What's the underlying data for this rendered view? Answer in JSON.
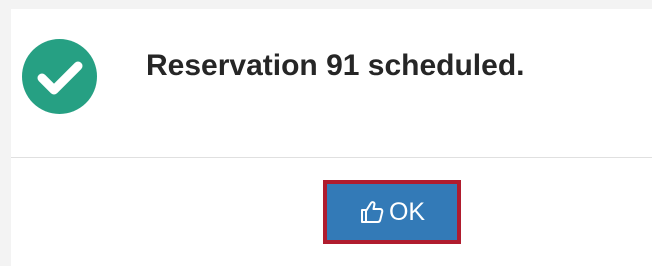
{
  "dialog": {
    "message": "Reservation 91 scheduled.",
    "status_icon": "check-circle-icon",
    "ok_button": {
      "label": "OK",
      "icon": "thumbs-up-icon"
    }
  },
  "colors": {
    "success": "#26a083",
    "button_bg": "#337ab7",
    "focus_border": "#b01c2e",
    "text": "#262626"
  }
}
